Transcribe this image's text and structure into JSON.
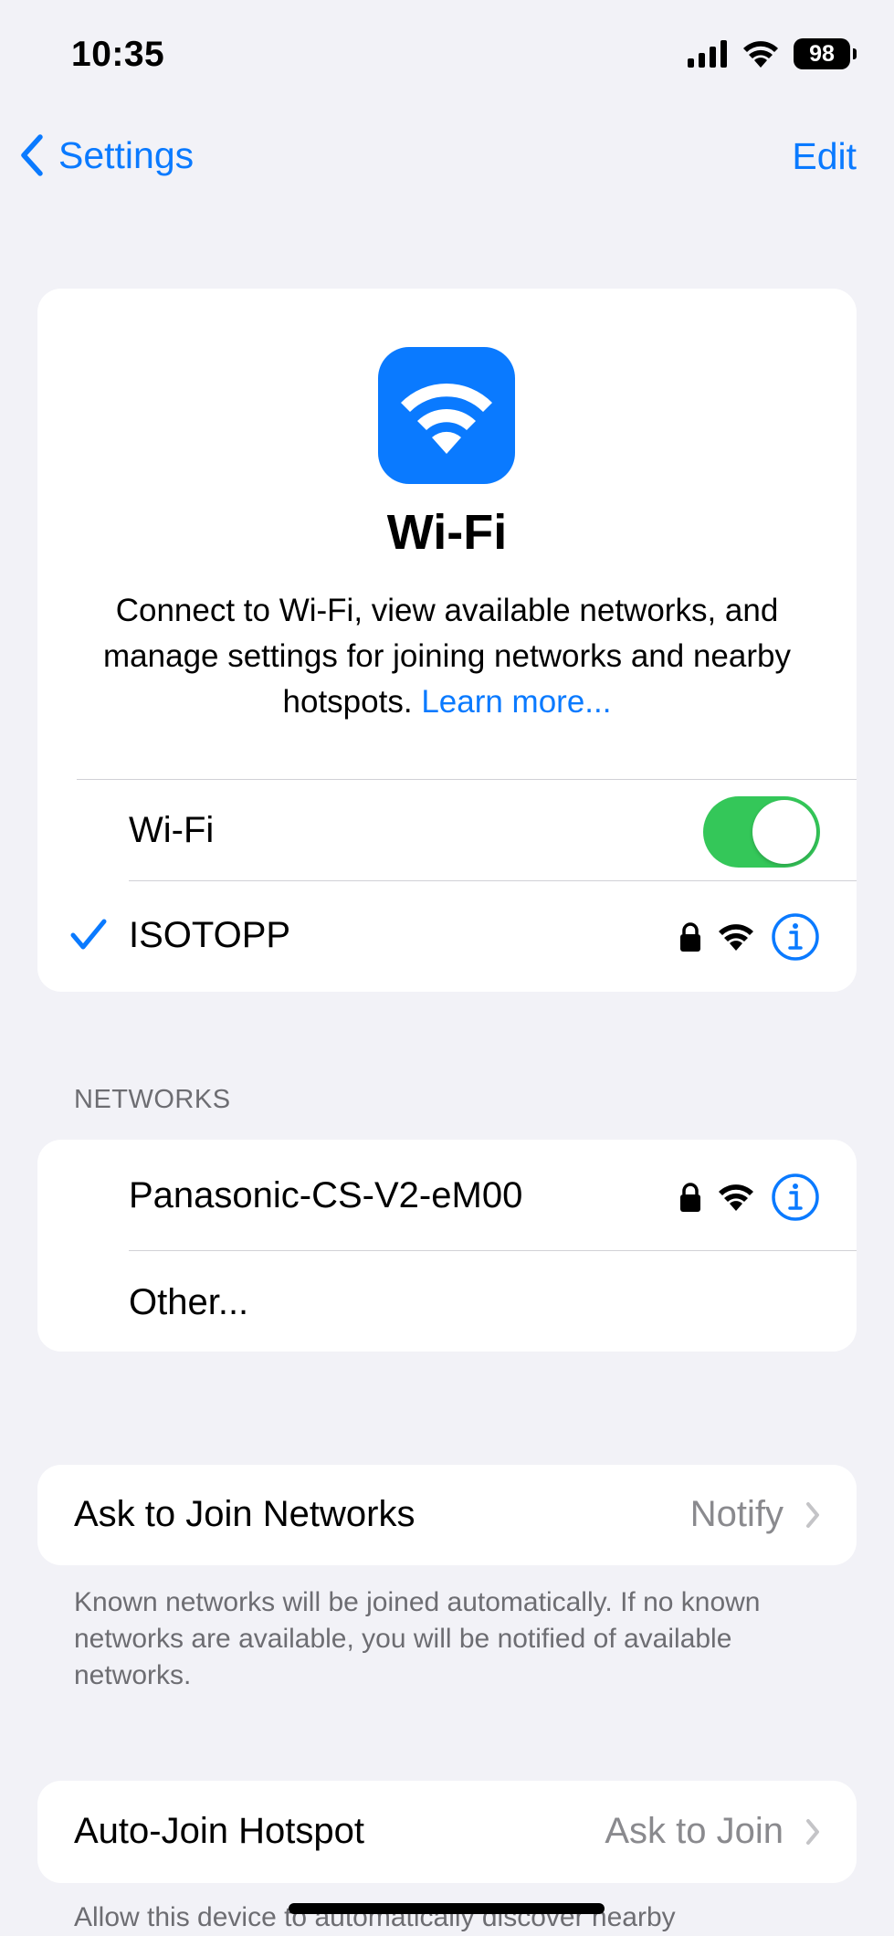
{
  "status_bar": {
    "time": "10:35",
    "battery": "98"
  },
  "nav": {
    "back_label": "Settings",
    "edit_label": "Edit"
  },
  "hero": {
    "title": "Wi-Fi",
    "description": "Connect to Wi-Fi, view available networks, and manage settings for joining networks and nearby hotspots.",
    "learn_more": "Learn more..."
  },
  "wifi_toggle": {
    "label": "Wi-Fi",
    "on": true
  },
  "current_network": {
    "name": "ISOTOPP",
    "secured": true,
    "connected": true
  },
  "networks": {
    "header": "NETWORKS",
    "items": [
      {
        "name": "Panasonic-CS-V2-eM00",
        "secured": true
      }
    ],
    "other_label": "Other..."
  },
  "ask_to_join": {
    "label": "Ask to Join Networks",
    "value": "Notify",
    "footer": "Known networks will be joined automatically. If no known networks are available, you will be notified of available networks."
  },
  "auto_join": {
    "label": "Auto-Join Hotspot",
    "value": "Ask to Join",
    "footer": "Allow this device to automatically discover nearby"
  },
  "colors": {
    "accent": "#0a7aff",
    "toggle_on": "#34c759",
    "background": "#f2f2f7"
  }
}
